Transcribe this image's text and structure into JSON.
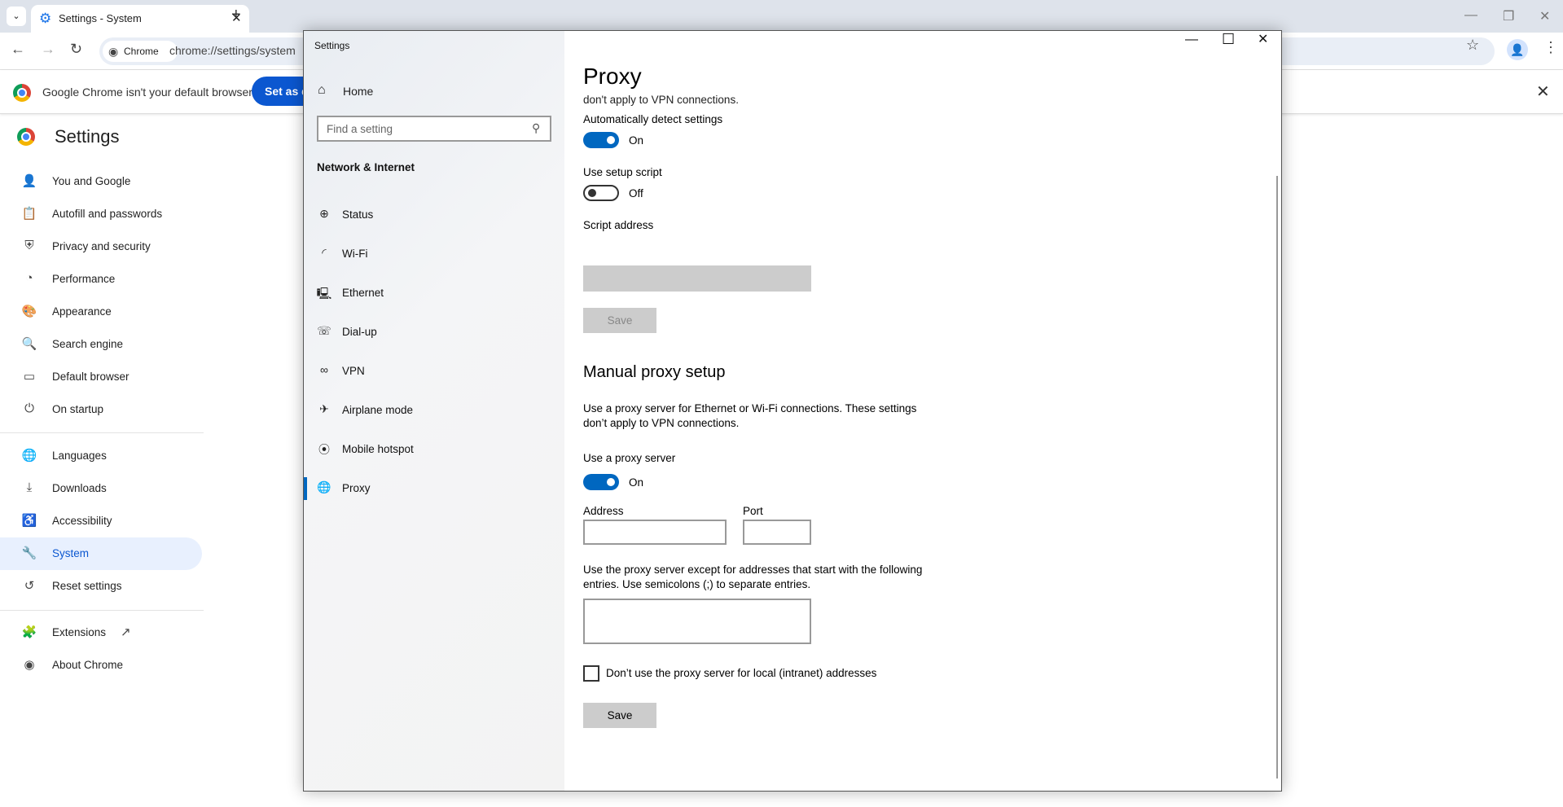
{
  "browser": {
    "tab_title": "Settings - System",
    "address_chip": "Chrome",
    "url": "chrome://settings/system",
    "infobar_message": "Google Chrome isn't your default browser",
    "set_default_label": "Set as default"
  },
  "chrome_settings": {
    "title": "Settings",
    "items": [
      {
        "label": "You and Google",
        "icon": "person-icon"
      },
      {
        "label": "Autofill and passwords",
        "icon": "clipboard-icon"
      },
      {
        "label": "Privacy and security",
        "icon": "shield-icon"
      },
      {
        "label": "Performance",
        "icon": "speedometer-icon"
      },
      {
        "label": "Appearance",
        "icon": "palette-icon"
      },
      {
        "label": "Search engine",
        "icon": "search-icon"
      },
      {
        "label": "Default browser",
        "icon": "browser-icon"
      },
      {
        "label": "On startup",
        "icon": "power-icon"
      },
      {
        "label": "Languages",
        "icon": "globe-icon"
      },
      {
        "label": "Downloads",
        "icon": "download-icon"
      },
      {
        "label": "Accessibility",
        "icon": "accessibility-icon"
      },
      {
        "label": "System",
        "icon": "wrench-icon",
        "selected": true
      },
      {
        "label": "Reset settings",
        "icon": "history-icon"
      },
      {
        "label": "Extensions",
        "icon": "puzzle-icon"
      },
      {
        "label": "About Chrome",
        "icon": "chrome-icon"
      }
    ]
  },
  "win_settings": {
    "window_title": "Settings",
    "home_label": "Home",
    "search_placeholder": "Find a setting",
    "section": "Network & Internet",
    "nav": [
      {
        "label": "Status",
        "icon": "globe-status-icon"
      },
      {
        "label": "Wi-Fi",
        "icon": "wifi-icon"
      },
      {
        "label": "Ethernet",
        "icon": "ethernet-icon"
      },
      {
        "label": "Dial-up",
        "icon": "phone-icon"
      },
      {
        "label": "VPN",
        "icon": "vpn-icon"
      },
      {
        "label": "Airplane mode",
        "icon": "airplane-icon"
      },
      {
        "label": "Mobile hotspot",
        "icon": "hotspot-icon"
      },
      {
        "label": "Proxy",
        "icon": "globe-icon",
        "selected": true
      }
    ],
    "page_title": "Proxy",
    "clipped_text": "don't apply to VPN connections.",
    "auto_detect_label": "Automatically detect settings",
    "auto_detect_state": "On",
    "setup_script_label": "Use setup script",
    "setup_script_state": "Off",
    "script_address_label": "Script address",
    "script_address_value": "",
    "save_label": "Save",
    "manual_title": "Manual proxy setup",
    "manual_desc_1": "Use a proxy server for Ethernet or Wi-Fi connections. These settings",
    "manual_desc_2": "don’t apply to VPN connections.",
    "use_proxy_label": "Use a proxy server",
    "use_proxy_state": "On",
    "address_label": "Address",
    "address_value": "",
    "port_label": "Port",
    "port_value": "",
    "except_desc_1": "Use the proxy server except for addresses that start with the following",
    "except_desc_2": "entries. Use semicolons (;) to separate entries.",
    "except_value": "",
    "local_checkbox_label": "Don’t use the proxy server for local (intranet) addresses",
    "local_checkbox_checked": false
  },
  "colors": {
    "accent": "#0067c0",
    "chrome_blue": "#0b57d0"
  }
}
